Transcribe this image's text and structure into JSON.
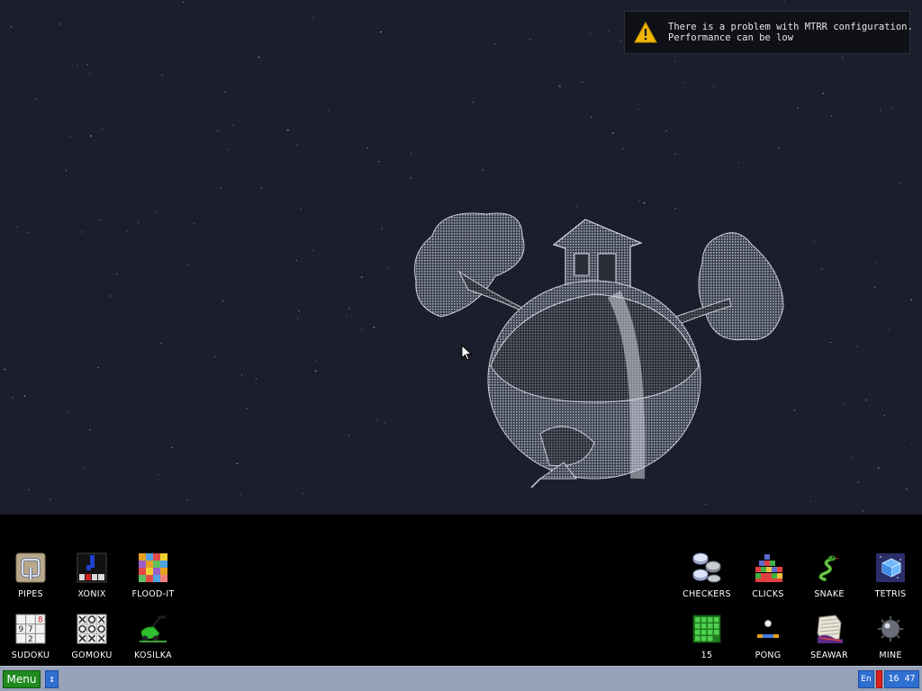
{
  "notification": {
    "line1": "There is a problem with MTRR configuration.",
    "line2": "Performance can be low",
    "icon": "warning-icon"
  },
  "apps": [
    {
      "id": "pipes",
      "label": "PIPES",
      "icon": "pipes-icon"
    },
    {
      "id": "xonix",
      "label": "XONIX",
      "icon": "xonix-icon"
    },
    {
      "id": "flood-it",
      "label": "FLOOD-IT",
      "icon": "flood-it-icon"
    },
    {
      "id": "sudoku",
      "label": "SUDOKU",
      "icon": "sudoku-icon"
    },
    {
      "id": "gomoku",
      "label": "GOMOKU",
      "icon": "gomoku-icon"
    },
    {
      "id": "kosilka",
      "label": "KOSILKA",
      "icon": "lawnmower-icon"
    },
    {
      "id": "checkers",
      "label": "CHECKERS",
      "icon": "checkers-icon"
    },
    {
      "id": "clicks",
      "label": "CLICKS",
      "icon": "clicks-icon"
    },
    {
      "id": "snake",
      "label": "SNAKE",
      "icon": "snake-icon"
    },
    {
      "id": "tetris",
      "label": "TETRIS",
      "icon": "tetris-icon"
    },
    {
      "id": "fifteen",
      "label": "15",
      "icon": "fifteen-puzzle-icon"
    },
    {
      "id": "pong",
      "label": "PONG",
      "icon": "pong-icon"
    },
    {
      "id": "seawar",
      "label": "SEAWAR",
      "icon": "seawar-icon"
    },
    {
      "id": "mine",
      "label": "MINE",
      "icon": "mine-icon"
    }
  ],
  "sudoku_digits": [
    "9",
    "7",
    "8",
    "2"
  ],
  "taskbar": {
    "menu_label": "Menu",
    "switch_symbol": "↕",
    "lang": "En",
    "clock": "16 47"
  },
  "colors": {
    "desktop_bg": "#1b1f2b",
    "taskbar_bg": "#98a2b8",
    "menu_green": "#1f8a1f",
    "tray_blue": "#2f6fd0",
    "warning_yellow": "#f2b705"
  }
}
